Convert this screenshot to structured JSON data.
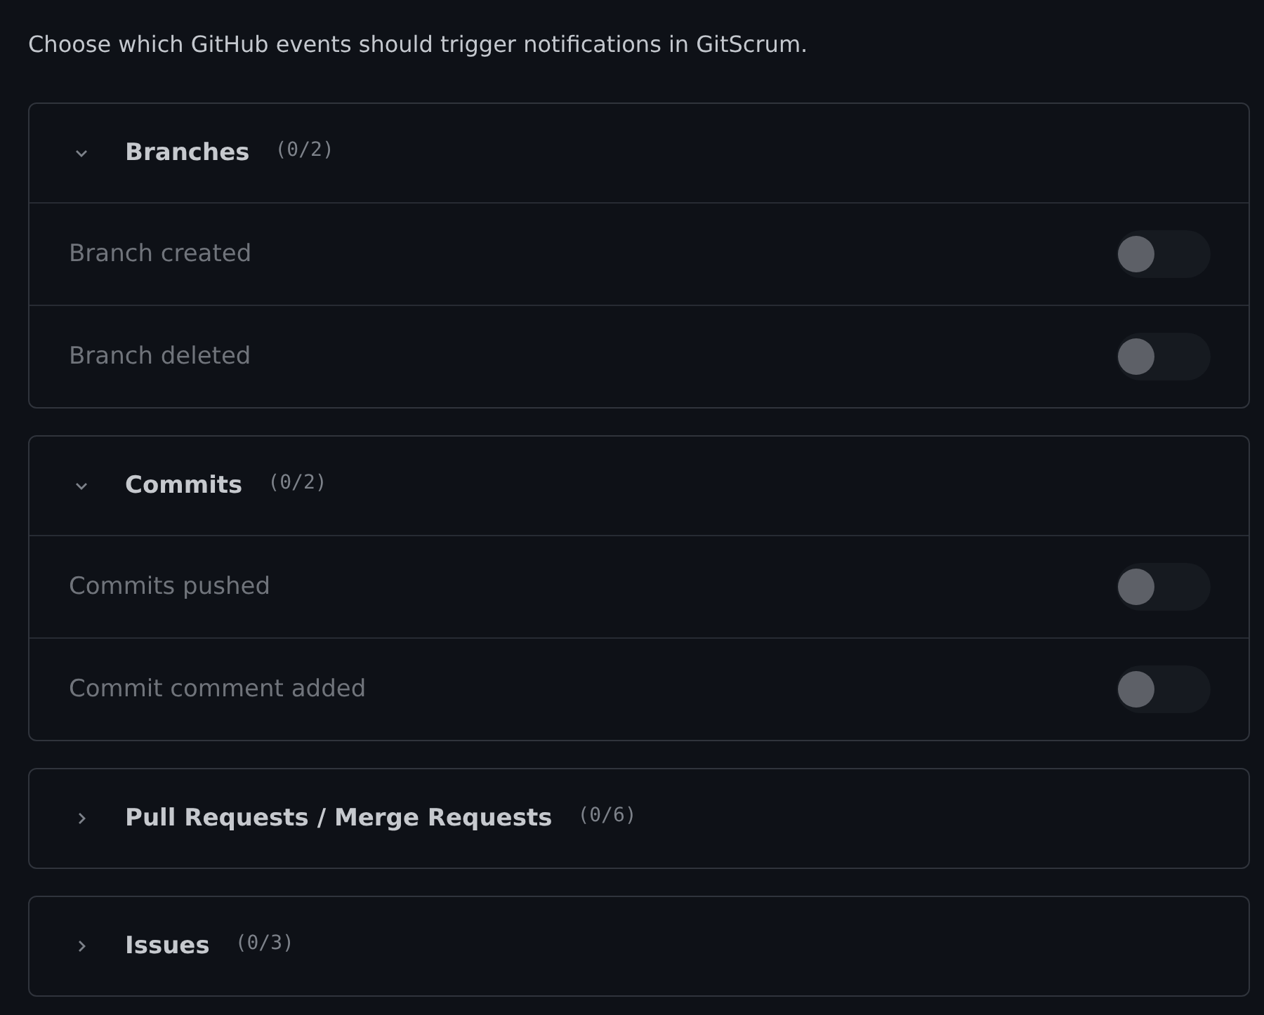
{
  "intro": "Choose which GitHub events should trigger notifications in GitScrum.",
  "sections": [
    {
      "title": "Branches",
      "count": "(0/2)",
      "expanded": true,
      "events": [
        {
          "label": "Branch created",
          "on": false
        },
        {
          "label": "Branch deleted",
          "on": false
        }
      ]
    },
    {
      "title": "Commits",
      "count": "(0/2)",
      "expanded": true,
      "events": [
        {
          "label": "Commits pushed",
          "on": false
        },
        {
          "label": "Commit comment added",
          "on": false
        }
      ]
    },
    {
      "title": "Pull Requests / Merge Requests",
      "count": "(0/6)",
      "expanded": false
    },
    {
      "title": "Issues",
      "count": "(0/3)",
      "expanded": false
    }
  ]
}
